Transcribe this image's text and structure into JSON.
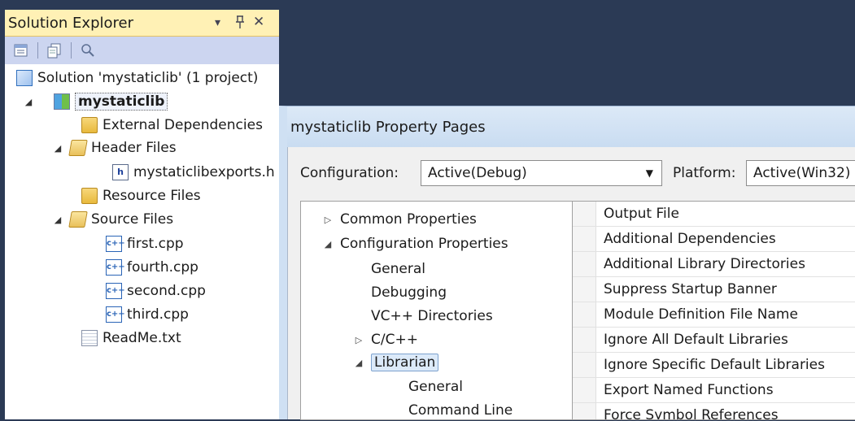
{
  "solution_explorer": {
    "title": "Solution Explorer",
    "controls": {
      "dropdown": "▾",
      "pin": "ᵖ",
      "close": "✕"
    },
    "toolbar": [
      {
        "icon": "properties-icon"
      },
      {
        "icon": "show-all-files-icon"
      },
      {
        "icon": "view-class-diagram-icon"
      }
    ],
    "tree": {
      "solution": "Solution 'mystaticlib' (1 project)",
      "project": "mystaticlib",
      "external_dependencies": "External Dependencies",
      "header_files": "Header Files",
      "header_file_1": "mystaticlibexports.h",
      "resource_files": "Resource Files",
      "source_files": "Source Files",
      "source_1": "first.cpp",
      "source_2": "fourth.cpp",
      "source_3": "second.cpp",
      "source_4": "third.cpp",
      "readme": "ReadMe.txt",
      "h_glyph": "h",
      "cpp_glyph": "c++"
    }
  },
  "dialog": {
    "title": "mystaticlib Property Pages",
    "configuration_label": "Configuration:",
    "configuration_value": "Active(Debug)",
    "platform_label": "Platform:",
    "platform_value": "Active(Win32)",
    "tree": {
      "common_properties": "Common Properties",
      "configuration_properties": "Configuration Properties",
      "general": "General",
      "debugging": "Debugging",
      "vc_directories": "VC++ Directories",
      "c_cpp": "C/C++",
      "librarian": "Librarian",
      "librarian_general": "General",
      "command_line": "Command Line"
    },
    "properties": [
      "Output File",
      "Additional Dependencies",
      "Additional Library Directories",
      "Suppress Startup Banner",
      "Module Definition File Name",
      "Ignore All Default Libraries",
      "Ignore Specific Default Libraries",
      "Export Named Functions",
      "Force Symbol References"
    ]
  },
  "colors": {
    "titlebar_yellow": "#fff1b5",
    "toolbar_blue": "#ccd5f0",
    "ide_background": "#2b3a55",
    "dialog_title": "#c9dcf1"
  }
}
